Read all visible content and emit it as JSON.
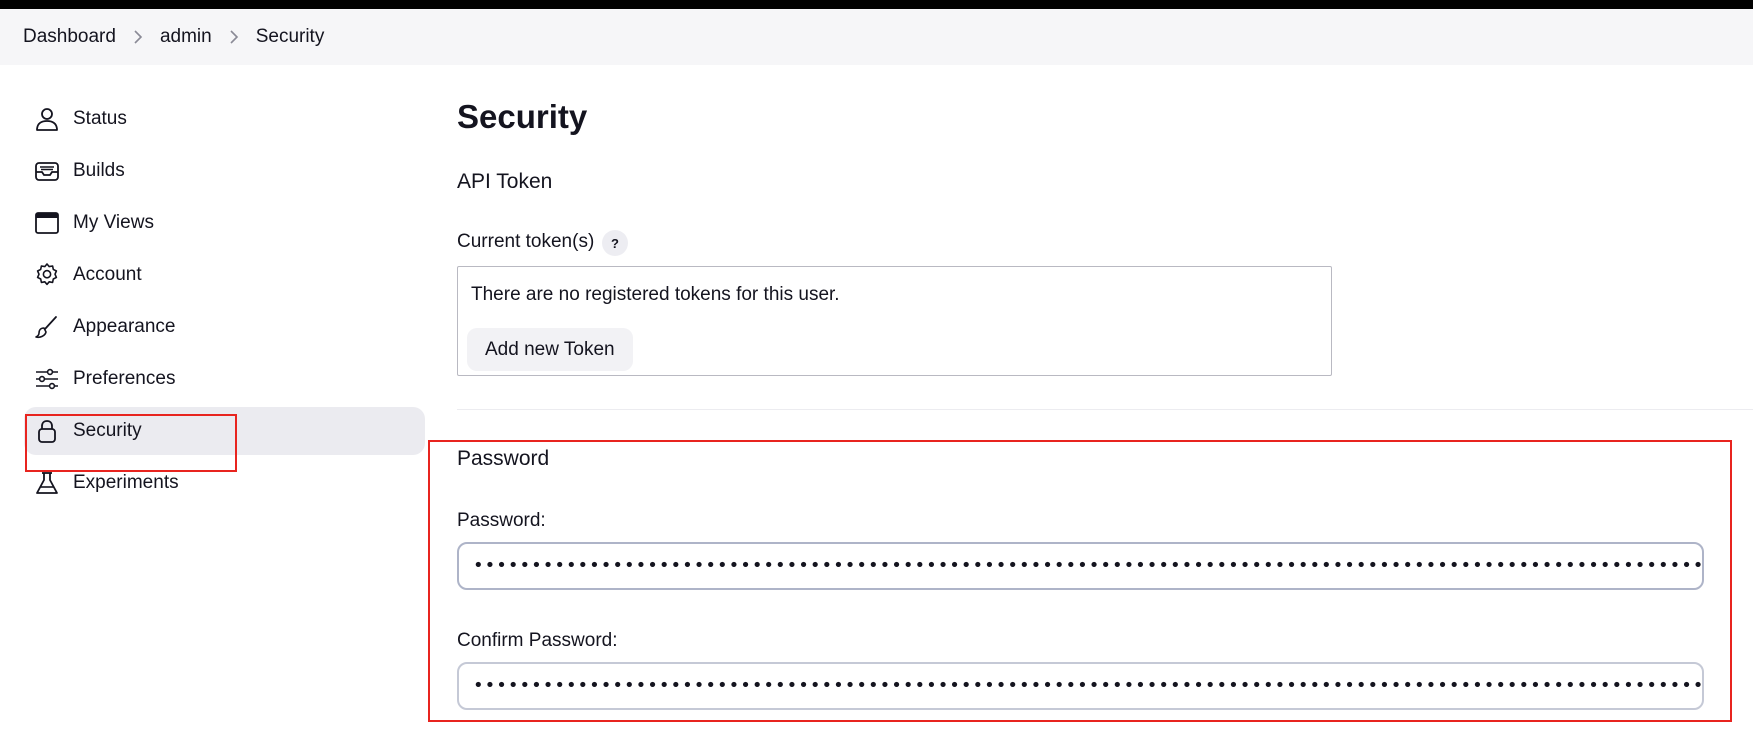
{
  "breadcrumb": [
    "Dashboard",
    "admin",
    "Security"
  ],
  "sidebar": {
    "items": [
      {
        "label": "Status",
        "icon": "user-icon"
      },
      {
        "label": "Builds",
        "icon": "inbox-icon"
      },
      {
        "label": "My Views",
        "icon": "window-icon"
      },
      {
        "label": "Account",
        "icon": "gear-icon"
      },
      {
        "label": "Appearance",
        "icon": "brush-icon"
      },
      {
        "label": "Preferences",
        "icon": "sliders-icon"
      },
      {
        "label": "Security",
        "icon": "lock-icon",
        "active": true
      },
      {
        "label": "Experiments",
        "icon": "flask-icon"
      }
    ]
  },
  "main": {
    "title": "Security",
    "api_token": {
      "heading": "API Token",
      "current_label": "Current token(s)",
      "help": "?",
      "empty_text": "There are no registered tokens for this user.",
      "add_button": "Add new Token"
    },
    "password": {
      "heading": "Password",
      "password_label": "Password:",
      "confirm_label": "Confirm Password:",
      "password_value": "••••••••••••••••••••••••••••••••••••••••••••••••••••••••••••••••••••••••••••••••••••••••••••••••••••••••••••••••••••••••••••••••••••••••••••••••••••••••••••••••••••••••••",
      "confirm_value": "••••••••••••••••••••••••••••••••••••••••••••••••••••••••••••••••••••••••••••••••••••••••••••••••••••••••••••••••••••••••••••••••••••••••••••••••••••••••••••••••••••••••••"
    }
  },
  "colors": {
    "annotation": "#e8241f",
    "active_item_bg": "#ebebf0",
    "breadcrumb_bg": "#f6f6f8"
  }
}
